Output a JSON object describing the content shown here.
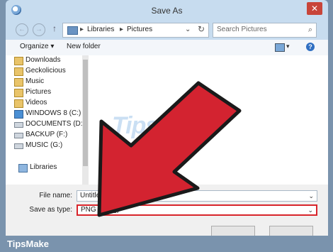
{
  "window": {
    "title": "Save As",
    "close_glyph": "✕"
  },
  "navbar": {
    "back_glyph": "←",
    "forward_glyph": "→",
    "up_glyph": "↑",
    "crumbs": [
      "Libraries",
      "Pictures"
    ],
    "separator": "▸",
    "dropdown_glyph": "⌄",
    "refresh_glyph": "↻",
    "search_placeholder": "Search Pictures",
    "search_glyph": "⌕"
  },
  "toolbar": {
    "organize": "Organize ▾",
    "new_folder": "New folder",
    "view_drop": "▾",
    "help_glyph": "?"
  },
  "nav_items": [
    {
      "label": "Downloads",
      "icon": "folder-icon"
    },
    {
      "label": "Geckolicious",
      "icon": "folder-icon"
    },
    {
      "label": "Music",
      "icon": "folder-icon"
    },
    {
      "label": "Pictures",
      "icon": "folder-icon"
    },
    {
      "label": "Videos",
      "icon": "folder-icon"
    },
    {
      "label": "WINDOWS 8 (C:)",
      "icon": "windows-drive-icon"
    },
    {
      "label": "DOCUMENTS (D:",
      "icon": "drive-icon"
    },
    {
      "label": "BACKUP (F:)",
      "icon": "drive-icon"
    },
    {
      "label": "MUSIC (G:)",
      "icon": "drive-icon"
    },
    {
      "label": "Libraries",
      "icon": "libraries-icon"
    }
  ],
  "form": {
    "filename_label": "File name:",
    "filename_value": "Untitled.png",
    "savetype_label": "Save as type:",
    "savetype_value": "PNG (*.png)",
    "chevron": "⌄"
  },
  "watermark": "TipsMake",
  "brand": "TipsMake",
  "colors": {
    "arrow": "#d32330",
    "highlight": "#d8252b",
    "brand_bar": "#7a93ad"
  }
}
